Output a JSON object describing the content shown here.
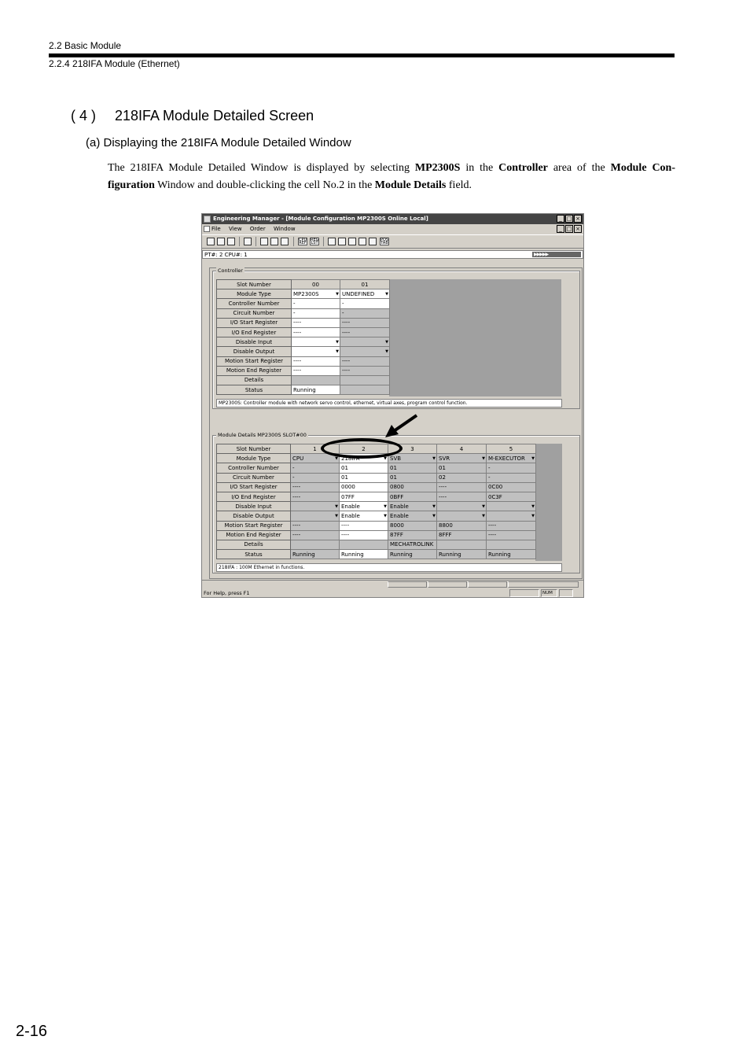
{
  "header": {
    "section": "2.2  Basic Module",
    "subsection": "2.2.4  218IFA Module (Ethernet)"
  },
  "heading": {
    "number": "( 4 )",
    "title": "218IFA Module Detailed Screen"
  },
  "subheading": "(a)  Displaying the 218IFA Module Detailed Window",
  "paragraph": {
    "t1": "The 218IFA Module Detailed Window is displayed by selecting ",
    "b1": "MP2300S",
    "t2": " in the ",
    "b2": "Controller",
    "t3": " area of the ",
    "b3": "Module Con-figuration",
    "t4": " Window and double-clicking the cell No.2 in the ",
    "b4": "Module Details",
    "t5": " field."
  },
  "window": {
    "title": "Engineering Manager - [Module Configuration      MP2300S  Online  Local]",
    "menu": [
      "File",
      "View",
      "Order",
      "Window"
    ],
    "toolbar_text_icons": [
      "CPU REF",
      "REG LST",
      "POS TAB"
    ],
    "pt_cpu": "PT#: 2 CPU#: 1",
    "arrows": "▶▶▶▶▶",
    "controller": {
      "label": "Controller",
      "row_headers": [
        "Slot Number",
        "Module Type",
        "Controller Number",
        "Circuit Number",
        "I/O Start Register",
        "I/O End Register",
        "Disable Input",
        "Disable Output",
        "Motion Start Register",
        "Motion End Register",
        "Details",
        "Status"
      ],
      "columns": [
        {
          "slot": "00",
          "module_type": "MP2300S",
          "controller_number": "-",
          "circuit_number": "-",
          "io_start": "----",
          "io_end": "----",
          "disable_input": "",
          "disable_output": "",
          "motion_start": "----",
          "motion_end": "----",
          "details": "",
          "status": "Running"
        },
        {
          "slot": "01",
          "module_type": "UNDEFINED",
          "controller_number": "-",
          "circuit_number": "-",
          "io_start": "----",
          "io_end": "----",
          "disable_input": "",
          "disable_output": "",
          "motion_start": "----",
          "motion_end": "----",
          "details": "",
          "status": ""
        }
      ],
      "description": "MP2300S: Controller module with network servo control, ethernet, virtual axes, program control function."
    },
    "module_details": {
      "label": "Module Details  MP2300S  SLOT#00",
      "columns": [
        {
          "slot": "1",
          "module_type": "CPU",
          "controller_number": "-",
          "circuit_number": "-",
          "io_start": "----",
          "io_end": "----",
          "disable_input": "",
          "disable_output": "",
          "motion_start": "----",
          "motion_end": "----",
          "details": "",
          "status": "Running"
        },
        {
          "slot": "2",
          "module_type": "218IFA",
          "controller_number": "01",
          "circuit_number": "01",
          "io_start": "0000",
          "io_end": "07FF",
          "disable_input": "Enable",
          "disable_output": "Enable",
          "motion_start": "----",
          "motion_end": "----",
          "details": "",
          "status": "Running"
        },
        {
          "slot": "3",
          "module_type": "SVB",
          "controller_number": "01",
          "circuit_number": "01",
          "io_start": "0800",
          "io_end": "0BFF",
          "disable_input": "Enable",
          "disable_output": "Enable",
          "motion_start": "8000",
          "motion_end": "87FF",
          "details": "MECHATROLINK",
          "status": "Running"
        },
        {
          "slot": "4",
          "module_type": "SVR",
          "controller_number": "01",
          "circuit_number": "02",
          "io_start": "----",
          "io_end": "----",
          "disable_input": "",
          "disable_output": "",
          "motion_start": "8800",
          "motion_end": "8FFF",
          "details": "",
          "status": "Running"
        },
        {
          "slot": "5",
          "module_type": "M-EXECUTOR",
          "controller_number": "-",
          "circuit_number": "-",
          "io_start": "0C00",
          "io_end": "0C3F",
          "disable_input": "",
          "disable_output": "",
          "motion_start": "----",
          "motion_end": "----",
          "details": "",
          "status": "Running"
        }
      ],
      "description": "218IFA : 100M Ethernet in functions."
    },
    "status_bar": {
      "help": "For Help, press F1",
      "num": "NUM"
    }
  },
  "page_number": "2-16"
}
